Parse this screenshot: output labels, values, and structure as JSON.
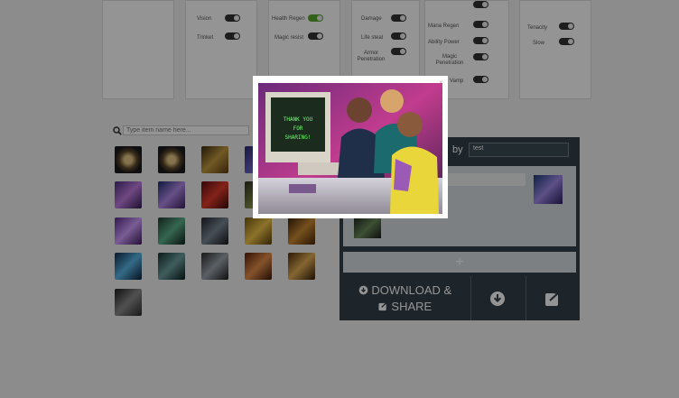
{
  "toggles": {
    "col1": [
      {
        "label": "Vision",
        "on": false
      },
      {
        "label": "Trinket",
        "on": false
      }
    ],
    "col2": [
      {
        "label": "Health Regen",
        "on": true
      },
      {
        "label": "Magic resist",
        "on": false
      }
    ],
    "col3": [
      {
        "label": "Damage",
        "on": false
      },
      {
        "label": "Life steal",
        "on": false
      },
      {
        "label": "Armor Penetration",
        "on": false
      }
    ],
    "col4": [
      {
        "label": "Mana Regen",
        "on": false
      },
      {
        "label": "Ability Power",
        "on": false
      },
      {
        "label": "Magic Penetration",
        "on": false
      },
      {
        "label": "Spell Vamp",
        "on": false
      }
    ],
    "col5": [
      {
        "label": "Tenacity",
        "on": false
      },
      {
        "label": "Slow",
        "on": false
      }
    ]
  },
  "search": {
    "placeholder": "Type item name here..."
  },
  "build": {
    "by_label": "by",
    "author_value": "test",
    "plus_label": "+",
    "download_line1": "DOWNLOAD &",
    "download_line2": "SHARE"
  },
  "modal": {
    "close_label": "×",
    "screen_text_1": "THANK YOU",
    "screen_text_2": "FOR",
    "screen_text_3": "SHARING!"
  },
  "colors": {
    "panel": "#334149",
    "accent_on": "#5aa82c",
    "overlay": "rgba(0,0,0,0.42)"
  }
}
